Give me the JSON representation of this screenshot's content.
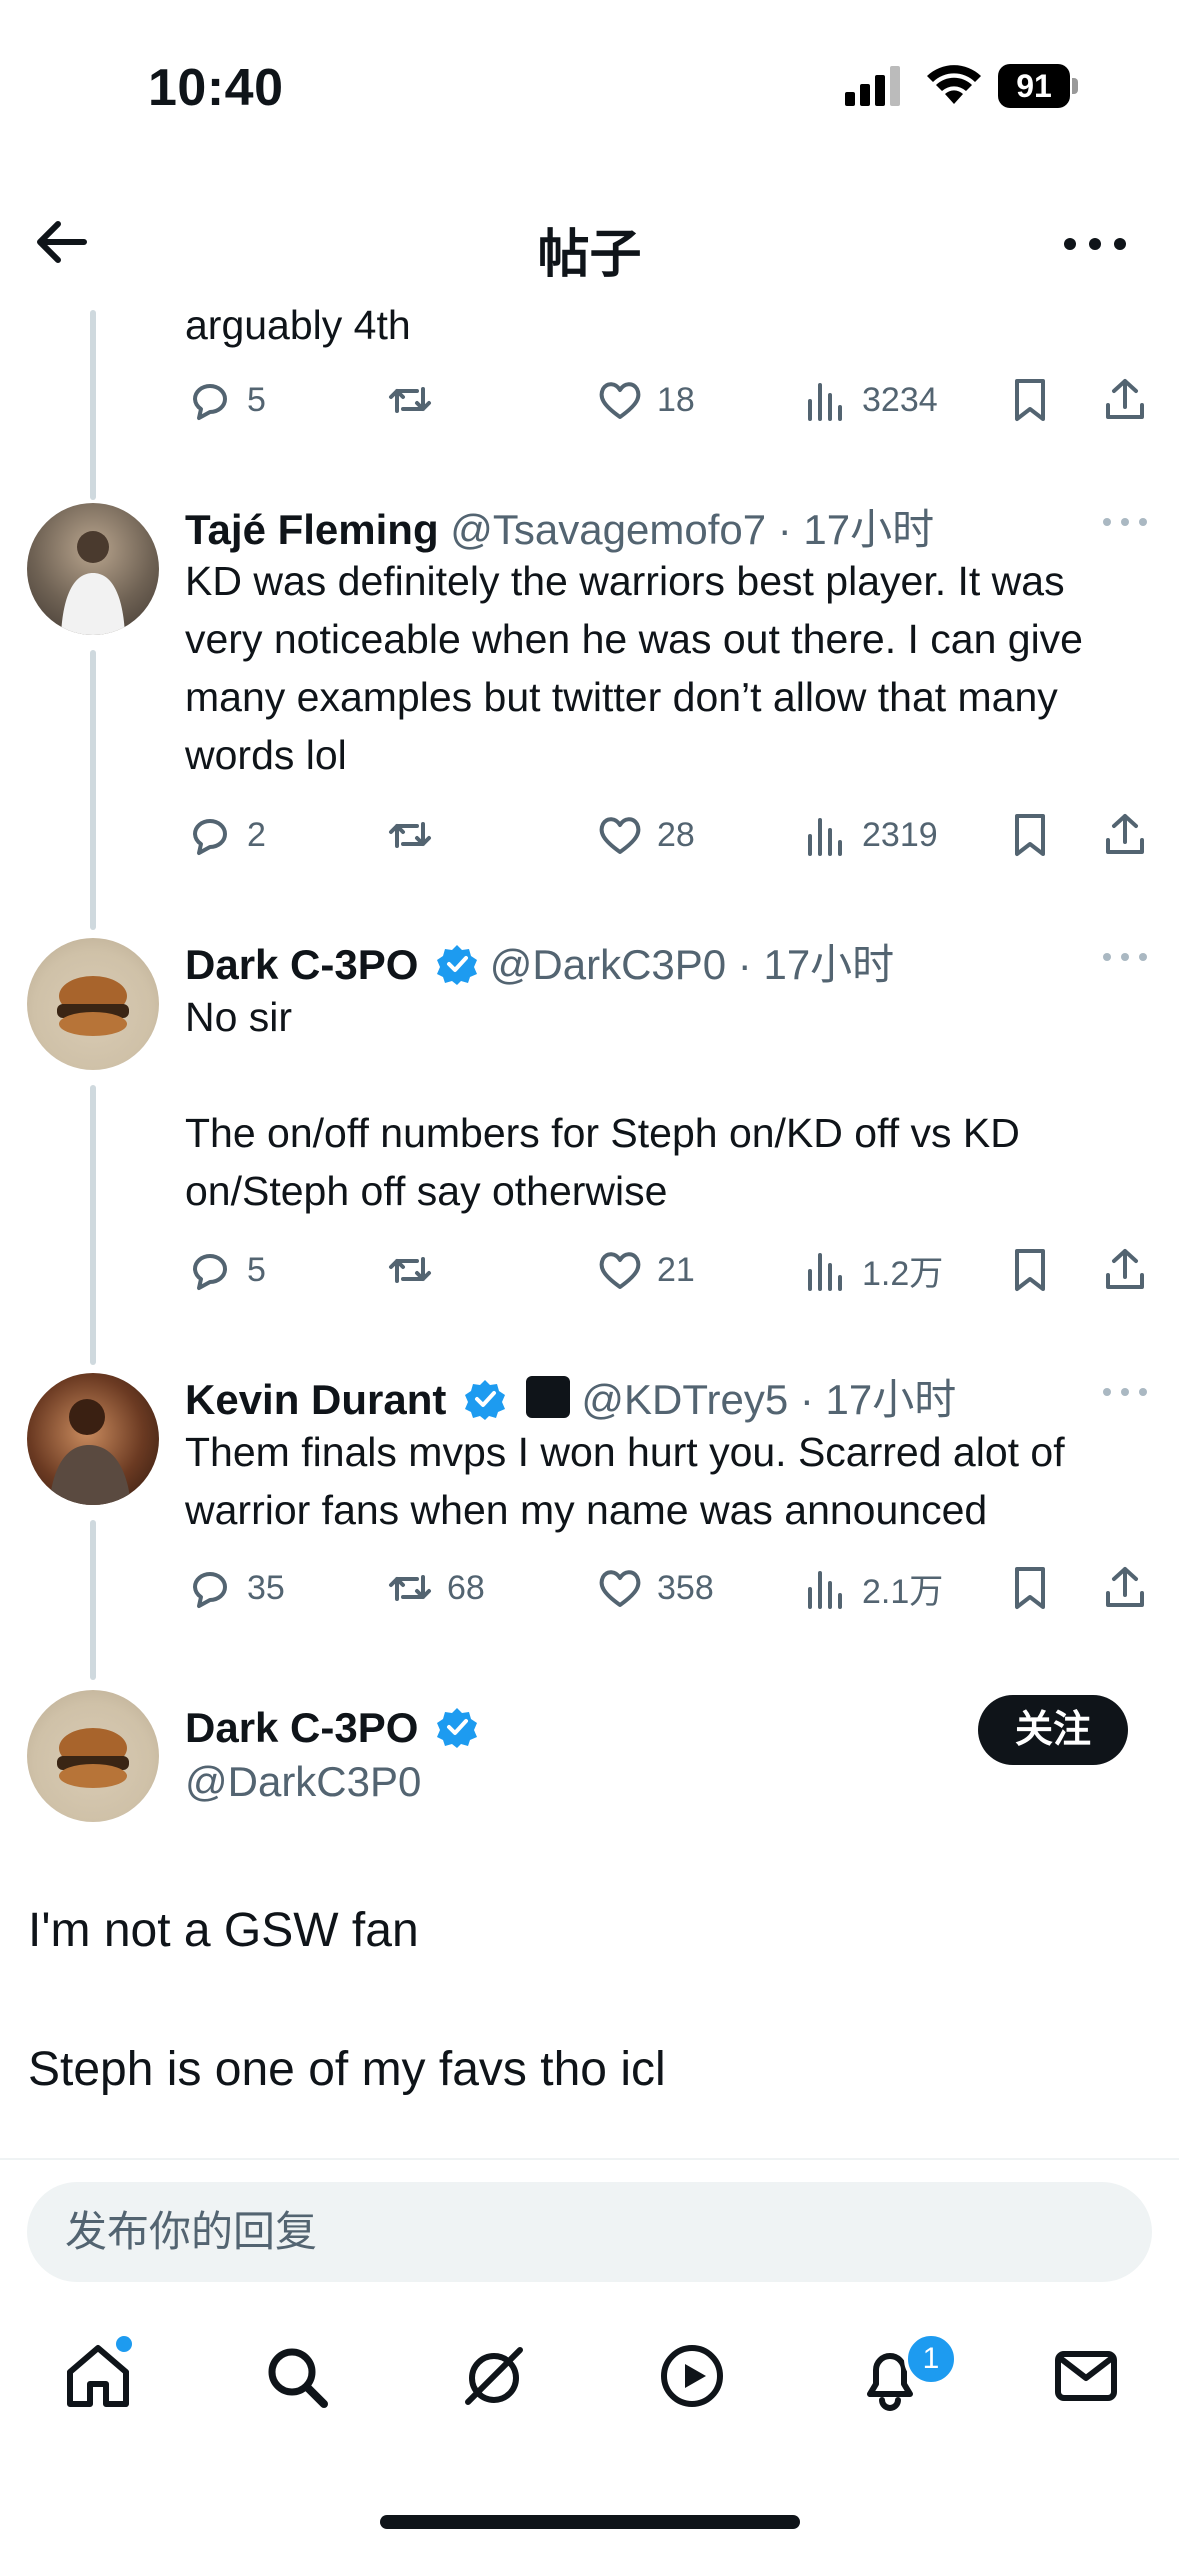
{
  "status_bar": {
    "time": "10:40",
    "battery": "91"
  },
  "header": {
    "title": "帖子"
  },
  "top_partial": {
    "text": "arguably 4th",
    "replies": "5",
    "retweets": "",
    "likes": "18",
    "views": "3234"
  },
  "tweets": [
    {
      "name": "Tajé Fleming",
      "handle": "@Tsavagemofo7 · 17小时",
      "text": "KD was definitely the warriors best player. It was very noticeable when he was out there. I can give many examples but twitter don’t allow that many words lol",
      "replies": "2",
      "retweets": "",
      "likes": "28",
      "views": "2319",
      "verified": false
    },
    {
      "name": "Dark C-3PO",
      "handle": "@DarkC3P0 · 17小时",
      "text": "No sir\n\nThe on/off numbers for Steph on/KD off vs KD on/Steph off say otherwise",
      "replies": "5",
      "retweets": "",
      "likes": "21",
      "views": "1.2万",
      "verified": true
    },
    {
      "name": "Kevin Durant",
      "handle": "@KDTrey5 · 17小时",
      "text": "Them finals mvps I won hurt you. Scarred alot of warrior fans when my name was announced",
      "replies": "35",
      "retweets": "68",
      "likes": "358",
      "views": "2.1万",
      "verified": true
    }
  ],
  "main_tweet": {
    "name": "Dark C-3PO",
    "handle": "@DarkC3P0",
    "follow_label": "关注",
    "line1": "I'm not a GSW fan",
    "line2": "Steph is one of my favs tho icl"
  },
  "reply_box": {
    "placeholder": "发布你的回复"
  },
  "nav": {
    "notification_count": "1"
  },
  "colors": {
    "accent": "#1d9bf0",
    "text": "#0f1419",
    "secondary": "#536471",
    "thread_line": "#cfd9de"
  }
}
